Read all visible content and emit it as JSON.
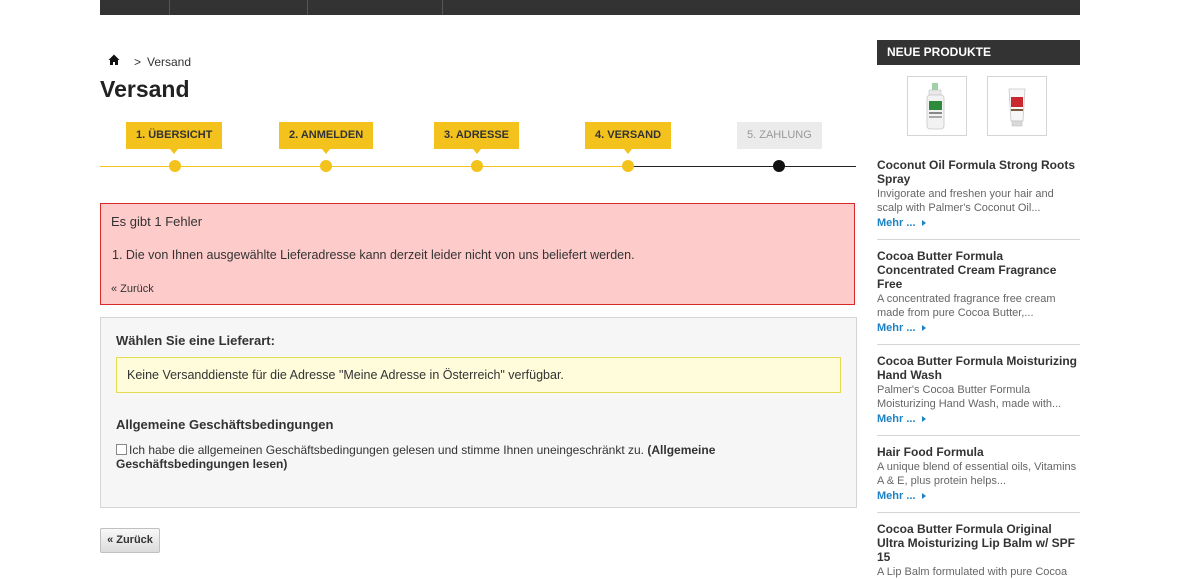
{
  "breadcrumb": {
    "separator": ">",
    "current": "Versand"
  },
  "page_title": "Versand",
  "steps": [
    {
      "label": "1. ÜBERSICHT",
      "state": "done"
    },
    {
      "label": "2. ANMELDEN",
      "state": "done"
    },
    {
      "label": "3. ADRESSE",
      "state": "done"
    },
    {
      "label": "4. VERSAND",
      "state": "current"
    },
    {
      "label": "5. ZAHLUNG",
      "state": "todo"
    }
  ],
  "error": {
    "title": "Es gibt 1 Fehler",
    "item": "1.  Die von Ihnen ausgewählte Lieferadresse kann derzeit leider nicht von uns beliefert werden.",
    "back": "« Zurück"
  },
  "shipping": {
    "heading": "Wählen Sie eine Lieferart:",
    "warning": "Keine Versanddienste für die Adresse \"Meine Adresse in Österreich\" verfügbar.",
    "terms_heading": "Allgemeine Geschäftsbedingungen",
    "terms_text": "Ich habe die allgemeinen Geschäftsbedingungen gelesen und stimme Ihnen uneingeschränkt zu.",
    "terms_link": "(Allgemeine Geschäftsbedingungen lesen)"
  },
  "back_button": "« Zurück",
  "sidebar": {
    "title": "NEUE PRODUKTE",
    "more_label": "Mehr ...",
    "products": [
      {
        "name": "Coconut Oil Formula Strong Roots Spray",
        "desc": "Invigorate and freshen your hair and scalp with Palmer's Coconut Oil..."
      },
      {
        "name": "Cocoa Butter Formula Concentrated Cream Fragrance Free",
        "desc": "A concentrated fragrance free cream made from pure Cocoa Butter,..."
      },
      {
        "name": "Cocoa Butter Formula Moisturizing Hand Wash",
        "desc": "Palmer's Cocoa Butter Formula Moisturizing Hand Wash, made with..."
      },
      {
        "name": "Hair Food Formula",
        "desc": "A unique blend of essential oils, Vitamins A & E, plus protein helps..."
      },
      {
        "name": "Cocoa Butter Formula Original Ultra Moisturizing Lip Balm w/ SPF 15",
        "desc": "A Lip Balm formulated with pure Cocoa"
      }
    ]
  },
  "colors": {
    "accent": "#f3c21c",
    "error_bg": "#fecbcb",
    "error_border": "#d92a2a",
    "link": "#1d83c4",
    "dark": "#333333"
  }
}
